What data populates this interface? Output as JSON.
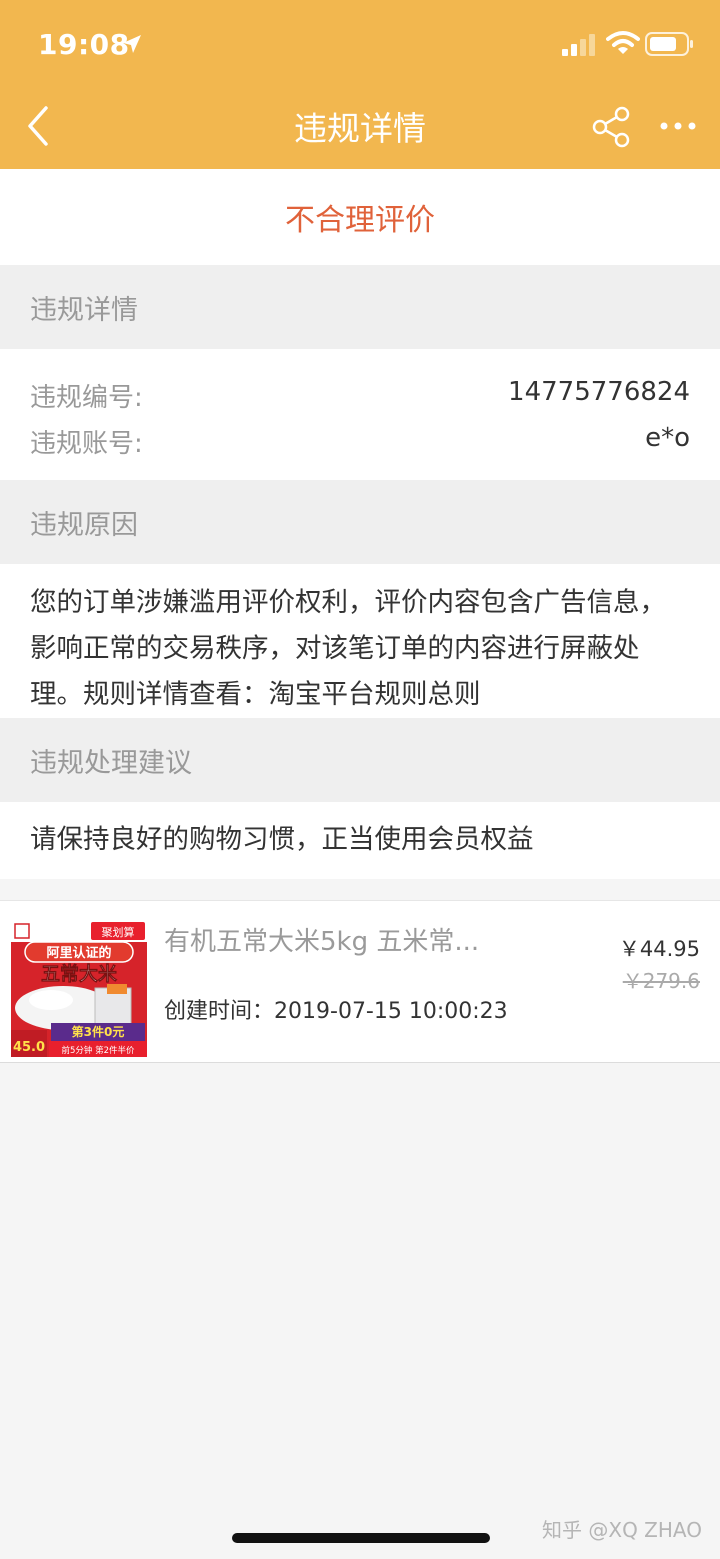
{
  "status_bar": {
    "time": "19:08"
  },
  "nav": {
    "title": "违规详情"
  },
  "violation_type": "不合理评价",
  "details_section": {
    "header": "违规详情",
    "rows": [
      {
        "label": "违规编号:",
        "value": "14775776824"
      },
      {
        "label": "违规账号:",
        "value": "e*o"
      }
    ]
  },
  "reason_section": {
    "header": "违规原因",
    "lines": [
      "您的订单涉嫌滥用评价权利，评价内容包含广告信息，",
      "影响正常的交易秩序，对该笔订单的内容进行屏蔽处",
      "理。规则详情查看：淘宝平台规则总则"
    ]
  },
  "advice_section": {
    "header": "违规处理建议",
    "text": "请保持良好的购物习惯，正当使用会员权益"
  },
  "order": {
    "product_name": "有机五常大米5kg 五米常...",
    "price_now": "￥44.95",
    "price_old": "￥279.6",
    "created_label": "创建时间：",
    "created_value": "2019-07-15 10:00:23",
    "thumb": {
      "badge_top": "聚划算",
      "headline_1": "阿里认证的",
      "headline_2": "五常大米",
      "price": "45.0",
      "promo": "第3件0元",
      "promo_sub": "前5分钟 第2件半价"
    }
  },
  "watermark": "知乎 @XQ ZHAO",
  "colors": {
    "header_bg": "#f2b74f",
    "violation_accent": "#e0623a",
    "section_bg": "#efefef"
  }
}
